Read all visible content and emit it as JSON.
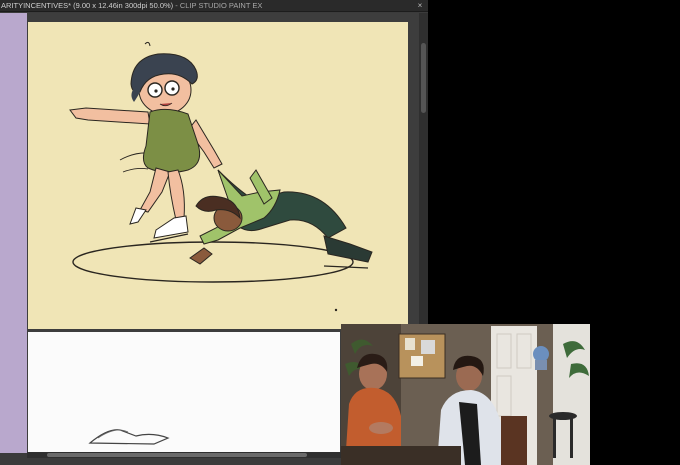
{
  "window": {
    "title": "ARITYINCENTIVES* (9.00 x 12.46in 300dpi 50.0%)",
    "app_name": " - CLIP STUDIO PAINT EX",
    "close_glyph": "×"
  },
  "colors": {
    "canvas_bg": "#f0e5b6",
    "side_panel": "#b9a8cd",
    "app_dark": "#3b3b3b"
  }
}
